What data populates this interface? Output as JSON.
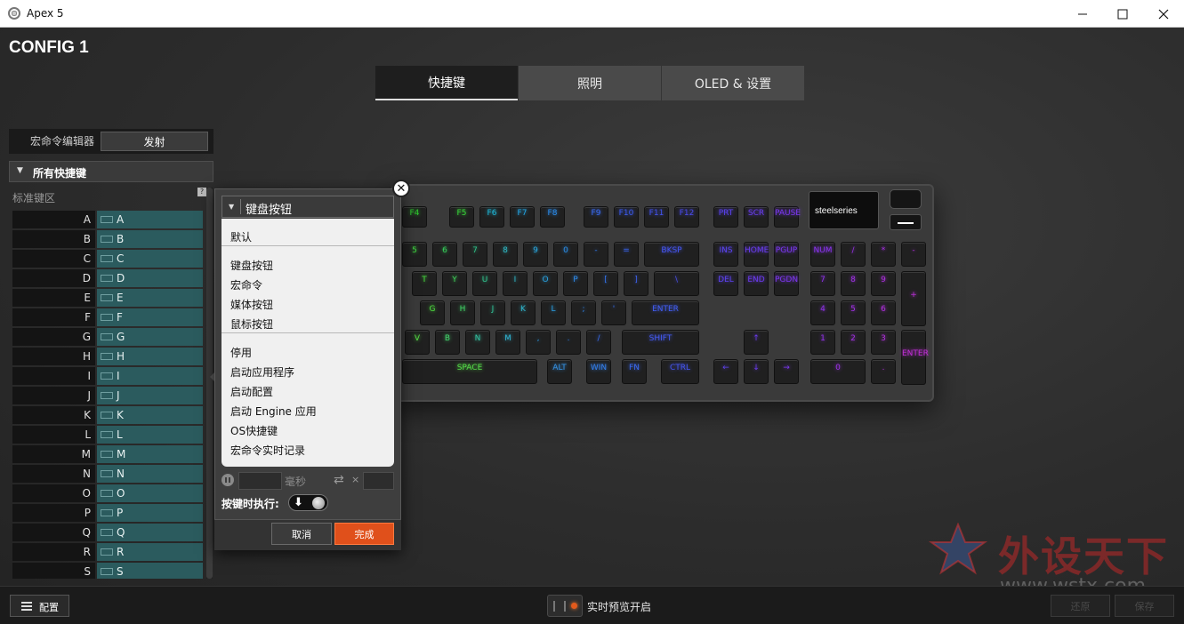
{
  "window": {
    "title": "Apex 5",
    "controls": {
      "minimize": "—",
      "maximize": "☐",
      "close": "✕"
    }
  },
  "header": {
    "config_title": "CONFIG 1",
    "tabs": [
      {
        "label": "快捷键",
        "active": true
      },
      {
        "label": "照明",
        "active": false
      },
      {
        "label": "OLED & 设置",
        "active": false
      }
    ]
  },
  "sidebar": {
    "macro_editor_label": "宏命令编辑器",
    "fire_label": "发射",
    "all_shortcuts_label": "所有快捷键",
    "standard_area_label": "标准键区",
    "help_badge": "?",
    "keys": [
      {
        "name": "A",
        "binding": "A"
      },
      {
        "name": "B",
        "binding": "B"
      },
      {
        "name": "C",
        "binding": "C"
      },
      {
        "name": "D",
        "binding": "D"
      },
      {
        "name": "E",
        "binding": "E"
      },
      {
        "name": "F",
        "binding": "F"
      },
      {
        "name": "G",
        "binding": "G"
      },
      {
        "name": "H",
        "binding": "H"
      },
      {
        "name": "I",
        "binding": "I"
      },
      {
        "name": "J",
        "binding": "J"
      },
      {
        "name": "K",
        "binding": "K"
      },
      {
        "name": "L",
        "binding": "L"
      },
      {
        "name": "M",
        "binding": "M"
      },
      {
        "name": "N",
        "binding": "N"
      },
      {
        "name": "O",
        "binding": "O"
      },
      {
        "name": "P",
        "binding": "P"
      },
      {
        "name": "Q",
        "binding": "Q"
      },
      {
        "name": "R",
        "binding": "R"
      },
      {
        "name": "S",
        "binding": "S"
      }
    ]
  },
  "popup": {
    "close_glyph": "✕",
    "dropdown_selected": "键盘按钮",
    "groups": [
      [
        "默认"
      ],
      [
        "键盘按钮",
        "宏命令",
        "媒体按钮",
        "鼠标按钮"
      ],
      [
        "停用",
        "启动应用程序",
        "启动配置",
        "启动 Engine 应用",
        "OS快捷键",
        "宏命令实时记录"
      ]
    ],
    "delay_unit": "毫秒",
    "repeat_glyph": "⇄",
    "repeat_x": "×",
    "on_press_label": "按键时执行:",
    "on_press_glyph": "🡇",
    "cancel_label": "取消",
    "done_label": "完成"
  },
  "keyboard": {
    "brand": "steelseries",
    "keys": [
      {
        "label": "F4",
        "color": "#2ec42e"
      },
      {
        "label": "F5",
        "color": "#39d63a"
      },
      {
        "label": "F6",
        "color": "#1fb7d8"
      },
      {
        "label": "F7",
        "color": "#23a8e8"
      },
      {
        "label": "F8",
        "color": "#2b8ff0"
      },
      {
        "label": "F9",
        "color": "#3a6cf5"
      },
      {
        "label": "F10",
        "color": "#3c5cf2"
      },
      {
        "label": "F11",
        "color": "#4354ef"
      },
      {
        "label": "F12",
        "color": "#4a4ced"
      },
      {
        "label": "PRT",
        "color": "#5a42ee"
      },
      {
        "label": "SCR",
        "color": "#6a3ef0"
      },
      {
        "label": "PAUSE",
        "color": "#7a38f0"
      },
      {
        "label": "5",
        "color": "#3fd641"
      },
      {
        "label": "6",
        "color": "#35cf5a"
      },
      {
        "label": "7",
        "color": "#2ec48a"
      },
      {
        "label": "8",
        "color": "#2fb8c4"
      },
      {
        "label": "9",
        "color": "#2aa7de"
      },
      {
        "label": "0",
        "color": "#2a8ee9"
      },
      {
        "label": "-",
        "color": "#3079ef"
      },
      {
        "label": "=",
        "color": "#3a66f2"
      },
      {
        "label": "BKSP",
        "color": "#4656f1"
      },
      {
        "label": "INS",
        "color": "#5a44ee"
      },
      {
        "label": "HOME",
        "color": "#6a3df0"
      },
      {
        "label": "PGUP",
        "color": "#7b37f0"
      },
      {
        "label": "NUM",
        "color": "#8a34ee"
      },
      {
        "label": "/",
        "color": "#9a32ea"
      },
      {
        "label": "*",
        "color": "#a631e4"
      },
      {
        "label": "-",
        "color": "#b230de"
      },
      {
        "label": "T",
        "color": "#47dc3e"
      },
      {
        "label": "Y",
        "color": "#3fd35a"
      },
      {
        "label": "U",
        "color": "#31c690"
      },
      {
        "label": "I",
        "color": "#2fb6c6"
      },
      {
        "label": "O",
        "color": "#2aa2e0"
      },
      {
        "label": "P",
        "color": "#2d8aea"
      },
      {
        "label": "[",
        "color": "#3375ef"
      },
      {
        "label": "]",
        "color": "#3d62f1"
      },
      {
        "label": "\\",
        "color": "#4b52f0"
      },
      {
        "label": "DEL",
        "color": "#5d42ee"
      },
      {
        "label": "END",
        "color": "#6c3bf0"
      },
      {
        "label": "PGDN",
        "color": "#7d36ef"
      },
      {
        "label": "7",
        "color": "#9032ec"
      },
      {
        "label": "8",
        "color": "#a031e6"
      },
      {
        "label": "9",
        "color": "#ae30df"
      },
      {
        "label": "+",
        "color": "#bb2fd9"
      },
      {
        "label": "G",
        "color": "#4ede3f"
      },
      {
        "label": "H",
        "color": "#40d265"
      },
      {
        "label": "J",
        "color": "#32c59a"
      },
      {
        "label": "K",
        "color": "#2fb4cc"
      },
      {
        "label": "L",
        "color": "#2b9fe2"
      },
      {
        "label": ";",
        "color": "#3087ec"
      },
      {
        "label": "'",
        "color": "#3771f0"
      },
      {
        "label": "ENTER",
        "color": "#425ef1"
      },
      {
        "label": "4",
        "color": "#9232ec"
      },
      {
        "label": "5",
        "color": "#a231e5"
      },
      {
        "label": "6",
        "color": "#b030de"
      },
      {
        "label": "V",
        "color": "#55df45"
      },
      {
        "label": "B",
        "color": "#43d26b"
      },
      {
        "label": "N",
        "color": "#33c4a2"
      },
      {
        "label": "M",
        "color": "#30b2d0"
      },
      {
        "label": ",",
        "color": "#2c9be4"
      },
      {
        "label": ".",
        "color": "#3083ed"
      },
      {
        "label": "/",
        "color": "#386df0"
      },
      {
        "label": "SHIFT",
        "color": "#445af1"
      },
      {
        "label": "↑",
        "color": "#6c3bf0"
      },
      {
        "label": "1",
        "color": "#9432eb"
      },
      {
        "label": "2",
        "color": "#a431e5"
      },
      {
        "label": "3",
        "color": "#b230dd"
      },
      {
        "label": "ENTER",
        "color": "#c02ed6"
      },
      {
        "label": "SPACE",
        "color": "#56e049"
      },
      {
        "label": "ALT",
        "color": "#3594e7"
      },
      {
        "label": "WIN",
        "color": "#3480ee"
      },
      {
        "label": "FN",
        "color": "#3a69f1"
      },
      {
        "label": "CTRL",
        "color": "#4656f1"
      },
      {
        "label": "←",
        "color": "#5e42ee"
      },
      {
        "label": "↓",
        "color": "#6c3bf0"
      },
      {
        "label": "→",
        "color": "#7b37f0"
      },
      {
        "label": "0",
        "color": "#9d31e7"
      },
      {
        "label": ".",
        "color": "#b030de"
      }
    ]
  },
  "bottombar": {
    "config_label": "配置",
    "live_preview_label": "实时预览开启",
    "revert_label": "还原",
    "save_label": "保存"
  },
  "watermark": {
    "name": "外设天下",
    "url": "www.wstx.com"
  }
}
